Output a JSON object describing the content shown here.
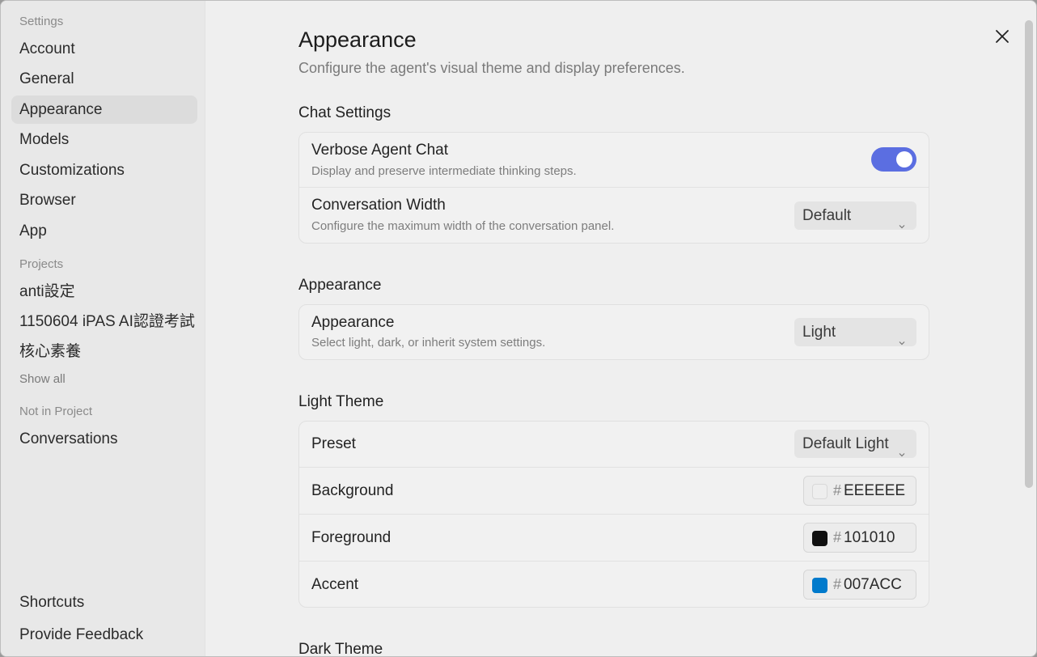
{
  "sidebar": {
    "settings_label": "Settings",
    "settings_items": [
      {
        "label": "Account"
      },
      {
        "label": "General"
      },
      {
        "label": "Appearance"
      },
      {
        "label": "Models"
      },
      {
        "label": "Customizations"
      },
      {
        "label": "Browser"
      },
      {
        "label": "App"
      }
    ],
    "projects_label": "Projects",
    "projects": [
      {
        "label": "anti設定"
      },
      {
        "label": "1150604 iPAS AI認證考試"
      },
      {
        "label": "核心素養"
      }
    ],
    "show_all": "Show all",
    "not_in_project_label": "Not in Project",
    "conversations": "Conversations",
    "shortcuts": "Shortcuts",
    "feedback": "Provide Feedback"
  },
  "main": {
    "title": "Appearance",
    "subtitle": "Configure the agent's visual theme and display preferences.",
    "chat_settings": {
      "heading": "Chat Settings",
      "verbose": {
        "title": "Verbose Agent Chat",
        "desc": "Display and preserve intermediate thinking steps.",
        "enabled": true
      },
      "width": {
        "title": "Conversation Width",
        "desc": "Configure the maximum width of the conversation panel.",
        "value": "Default"
      }
    },
    "appearance_section": {
      "heading": "Appearance",
      "row": {
        "title": "Appearance",
        "desc": "Select light, dark, or inherit system settings.",
        "value": "Light"
      }
    },
    "light_theme": {
      "heading": "Light Theme",
      "preset": {
        "title": "Preset",
        "value": "Default Light"
      },
      "background": {
        "title": "Background",
        "hash": "#",
        "value": "EEEEEE",
        "color": "#EEEEEE"
      },
      "foreground": {
        "title": "Foreground",
        "hash": "#",
        "value": "101010",
        "color": "#101010"
      },
      "accent": {
        "title": "Accent",
        "hash": "#",
        "value": "007ACC",
        "color": "#007ACC"
      }
    },
    "dark_theme": {
      "heading": "Dark Theme"
    }
  },
  "colors": {
    "toggle_on": "#5B6EE1",
    "sidebar_bg": "#E8E8E8",
    "content_bg": "#EFEFEF"
  },
  "icons": {
    "close": "close-icon",
    "chevron": "chevron-down-icon"
  }
}
